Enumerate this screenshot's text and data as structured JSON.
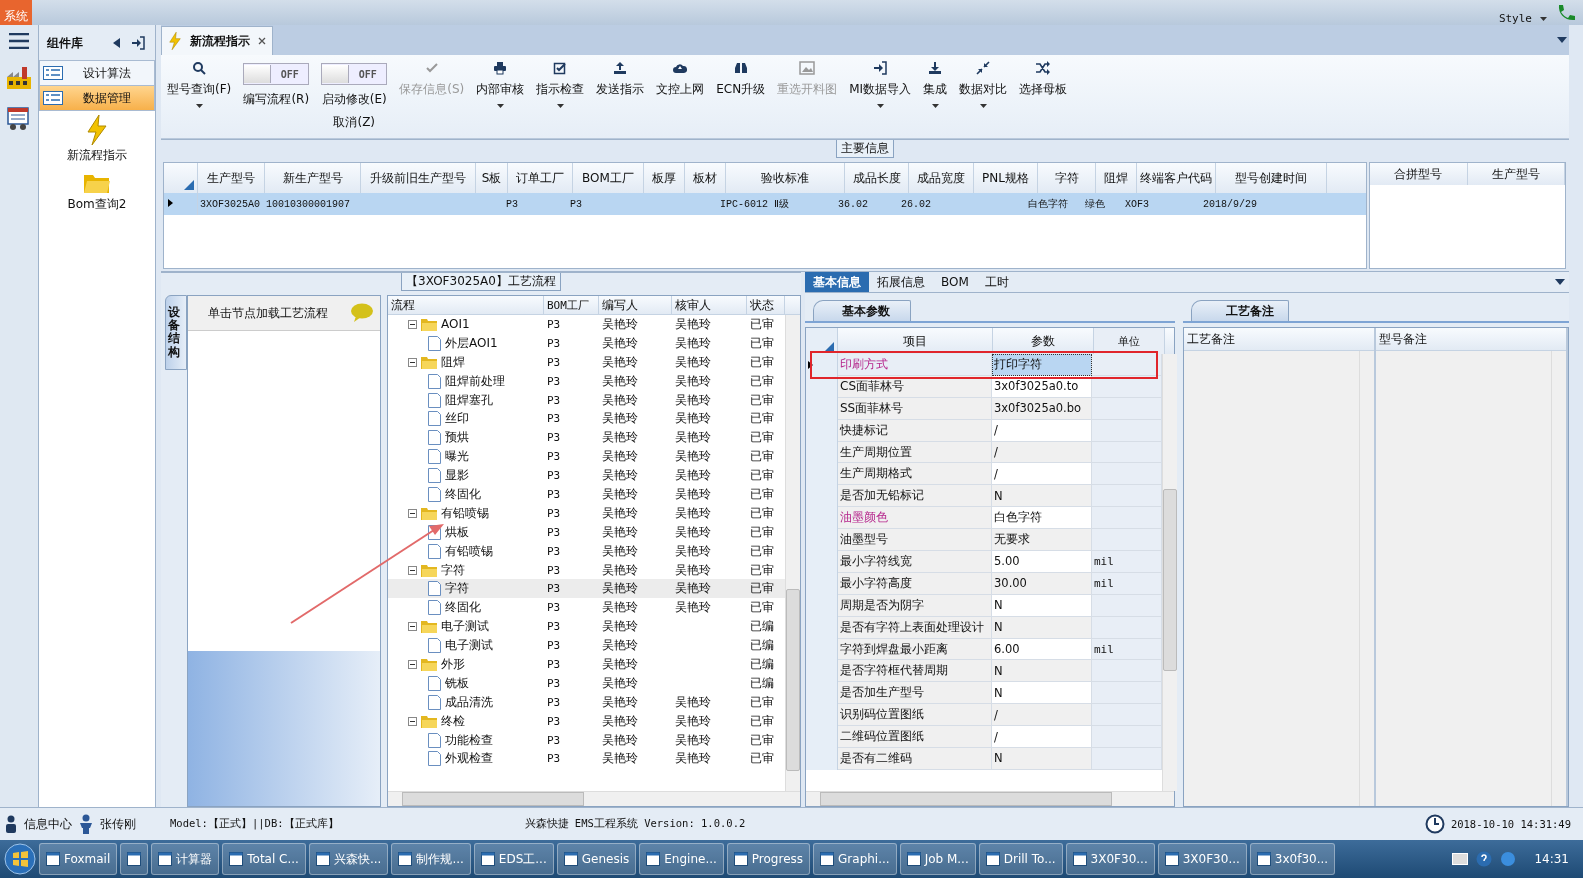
{
  "title_bar": {
    "system_tab": "系统",
    "style_menu": "Style"
  },
  "nav_panel": {
    "title": "组件库",
    "items": [
      {
        "label": "设计算法",
        "selected": false
      },
      {
        "label": "数据管理",
        "selected": true
      }
    ],
    "shortcuts": [
      "新流程指示",
      "Bom查询2"
    ]
  },
  "doc_tab": {
    "label": "新流程指示"
  },
  "toolbar": [
    {
      "kind": "button",
      "label": "型号查询(F)",
      "dropdown": true,
      "disabled": false
    },
    {
      "kind": "toggle",
      "label": "编写流程(R)",
      "state_text": "OFF",
      "on": false
    },
    {
      "kind": "toggle",
      "label": "启动修改(E)",
      "sublabel": "取消(Z)",
      "state_text": "OFF",
      "on": false
    },
    {
      "kind": "button",
      "label": "保存信息(S)",
      "dropdown": false,
      "disabled": true
    },
    {
      "kind": "button",
      "label": "内部审核",
      "dropdown": true,
      "disabled": false
    },
    {
      "kind": "button",
      "label": "指示检查",
      "dropdown": true,
      "disabled": false
    },
    {
      "kind": "button",
      "label": "发送指示",
      "dropdown": false,
      "disabled": false
    },
    {
      "kind": "button",
      "label": "文控上网",
      "dropdown": false,
      "disabled": false
    },
    {
      "kind": "button",
      "label": "ECN升级",
      "dropdown": false,
      "disabled": false
    },
    {
      "kind": "button",
      "label": "重选开料图",
      "dropdown": false,
      "disabled": true
    },
    {
      "kind": "button",
      "label": "MI数据导入",
      "dropdown": true,
      "disabled": false
    },
    {
      "kind": "button",
      "label": "集成",
      "dropdown": true,
      "disabled": false
    },
    {
      "kind": "button",
      "label": "数据对比",
      "dropdown": true,
      "disabled": false
    },
    {
      "kind": "button",
      "label": "选择母板",
      "dropdown": false,
      "disabled": false
    }
  ],
  "main_info": {
    "title": "主要信息",
    "columns": [
      "生产型号",
      "新生产型号",
      "升级前旧生产型号",
      "S板",
      "订单工厂",
      "BOM工厂",
      "板厚",
      "板材",
      "验收标准",
      "成品长度",
      "成品宽度",
      "PNL规格",
      "字符",
      "阻焊",
      "终端客户代码",
      "型号创建时间"
    ],
    "rows": [
      {
        "selected": true,
        "cells": [
          "3XOF3025A0",
          "10010300001907",
          null,
          null,
          "P3",
          "P3",
          null,
          null,
          "IPC-6012 Ⅱ级",
          "36.02",
          "26.02",
          null,
          "白色字符",
          "绿色",
          "XOF3",
          "2018/9/29"
        ]
      }
    ],
    "side_columns": [
      "合拼型号",
      "生产型号"
    ]
  },
  "process_panel": {
    "title": "【3XOF3025A0】工艺流程",
    "side_tab": "设备结构",
    "hint": "单击节点加载工艺流程",
    "tree": {
      "columns": [
        "流程",
        "BOM工厂",
        "编写人",
        "核审人",
        "状态"
      ],
      "nodes": [
        {
          "name": "AOI1",
          "bom": "P3",
          "writer": "吴艳玲",
          "reviewer": "吴艳玲",
          "status": "已审",
          "expanded": true,
          "selected": false,
          "children": [
            {
              "name": "外层AOI1",
              "bom": "P3",
              "writer": "吴艳玲",
              "reviewer": "吴艳玲",
              "status": "已审",
              "selected": false
            }
          ]
        },
        {
          "name": "阻焊",
          "bom": "P3",
          "writer": "吴艳玲",
          "reviewer": "吴艳玲",
          "status": "已审",
          "expanded": true,
          "selected": false,
          "children": [
            {
              "name": "阻焊前处理",
              "bom": "P3",
              "writer": "吴艳玲",
              "reviewer": "吴艳玲",
              "status": "已审",
              "selected": false
            },
            {
              "name": "阻焊塞孔",
              "bom": "P3",
              "writer": "吴艳玲",
              "reviewer": "吴艳玲",
              "status": "已审",
              "selected": false
            },
            {
              "name": "丝印",
              "bom": "P3",
              "writer": "吴艳玲",
              "reviewer": "吴艳玲",
              "status": "已审",
              "selected": false
            },
            {
              "name": "预烘",
              "bom": "P3",
              "writer": "吴艳玲",
              "reviewer": "吴艳玲",
              "status": "已审",
              "selected": false
            },
            {
              "name": "曝光",
              "bom": "P3",
              "writer": "吴艳玲",
              "reviewer": "吴艳玲",
              "status": "已审",
              "selected": false
            },
            {
              "name": "显影",
              "bom": "P3",
              "writer": "吴艳玲",
              "reviewer": "吴艳玲",
              "status": "已审",
              "selected": false
            },
            {
              "name": "终固化",
              "bom": "P3",
              "writer": "吴艳玲",
              "reviewer": "吴艳玲",
              "status": "已审",
              "selected": false
            }
          ]
        },
        {
          "name": "有铅喷锡",
          "bom": "P3",
          "writer": "吴艳玲",
          "reviewer": "吴艳玲",
          "status": "已审",
          "expanded": true,
          "selected": false,
          "children": [
            {
              "name": "烘板",
              "bom": "P3",
              "writer": "吴艳玲",
              "reviewer": "吴艳玲",
              "status": "已审",
              "selected": false
            },
            {
              "name": "有铅喷锡",
              "bom": "P3",
              "writer": "吴艳玲",
              "reviewer": "吴艳玲",
              "status": "已审",
              "selected": false
            }
          ]
        },
        {
          "name": "字符",
          "bom": "P3",
          "writer": "吴艳玲",
          "reviewer": "吴艳玲",
          "status": "已审",
          "expanded": true,
          "selected": false,
          "children": [
            {
              "name": "字符",
              "bom": "P3",
              "writer": "吴艳玲",
              "reviewer": "吴艳玲",
              "status": "已审",
              "selected": true
            },
            {
              "name": "终固化",
              "bom": "P3",
              "writer": "吴艳玲",
              "reviewer": "吴艳玲",
              "status": "已审",
              "selected": false
            }
          ]
        },
        {
          "name": "电子测试",
          "bom": "P3",
          "writer": "吴艳玲",
          "status": "已编",
          "expanded": true,
          "selected": false,
          "children": [
            {
              "name": "电子测试",
              "bom": "P3",
              "writer": "吴艳玲",
              "status": "已编",
              "selected": false
            }
          ]
        },
        {
          "name": "外形",
          "bom": "P3",
          "writer": "吴艳玲",
          "status": "已编",
          "expanded": true,
          "selected": false,
          "children": [
            {
              "name": "铣板",
              "bom": "P3",
              "writer": "吴艳玲",
              "status": "已编",
              "selected": false
            },
            {
              "name": "成品清洗",
              "bom": "P3",
              "writer": "吴艳玲",
              "reviewer": "吴艳玲",
              "status": "已审",
              "selected": false
            }
          ]
        },
        {
          "name": "终检",
          "bom": "P3",
          "writer": "吴艳玲",
          "reviewer": "吴艳玲",
          "status": "已审",
          "expanded": true,
          "selected": false,
          "children": [
            {
              "name": "功能检查",
              "bom": "P3",
              "writer": "吴艳玲",
              "reviewer": "吴艳玲",
              "status": "已审",
              "selected": false
            },
            {
              "name": "外观检查",
              "bom": "P3",
              "writer": "吴艳玲",
              "reviewer": "吴艳玲",
              "status": "已审",
              "selected": false
            }
          ]
        }
      ]
    }
  },
  "detail_tabs": [
    {
      "label": "基本信息",
      "selected": true
    },
    {
      "label": "拓展信息",
      "selected": false
    },
    {
      "label": "BOM",
      "selected": false
    },
    {
      "label": "工时",
      "selected": false
    }
  ],
  "params": {
    "tab": "基本参数",
    "columns": [
      "项目",
      "参数",
      "单位"
    ],
    "rows": [
      {
        "item": "印刷方式",
        "value": "打印字符",
        "required": true,
        "selected": true
      },
      {
        "item": "CS面菲林号",
        "value": "3x0f3025a0.to",
        "required": false,
        "selected": false
      },
      {
        "item": "SS面菲林号",
        "value": "3x0f3025a0.bo",
        "required": false,
        "selected": false
      },
      {
        "item": "快捷标记",
        "value": "/",
        "required": false,
        "selected": false
      },
      {
        "item": "生产周期位置",
        "value": "/",
        "required": false,
        "selected": false
      },
      {
        "item": "生产周期格式",
        "value": "/",
        "required": false,
        "selected": false
      },
      {
        "item": "是否加无铅标记",
        "value": "N",
        "required": false,
        "selected": false
      },
      {
        "item": "油墨颜色",
        "value": "白色字符",
        "required": true,
        "selected": false
      },
      {
        "item": "油墨型号",
        "value": "无要求",
        "required": false,
        "selected": false
      },
      {
        "item": "最小字符线宽",
        "value": "5.00",
        "unit": "mil",
        "required": false,
        "selected": false
      },
      {
        "item": "最小字符高度",
        "value": "30.00",
        "unit": "mil",
        "required": false,
        "selected": false
      },
      {
        "item": "周期是否为阴字",
        "value": "N",
        "required": false,
        "selected": false
      },
      {
        "item": "是否有字符上表面处理设计",
        "value": "N",
        "required": false,
        "selected": false
      },
      {
        "item": "字符到焊盘最小距离",
        "value": "6.00",
        "unit": "mil",
        "required": false,
        "selected": false
      },
      {
        "item": "是否字符框代替周期",
        "value": "N",
        "required": false,
        "selected": false
      },
      {
        "item": "是否加生产型号",
        "value": "N",
        "required": false,
        "selected": false
      },
      {
        "item": "识别码位置图纸",
        "value": "/",
        "required": false,
        "selected": false
      },
      {
        "item": "二维码位置图纸",
        "value": "/",
        "required": false,
        "selected": false
      },
      {
        "item": "是否有二维码",
        "value": "N",
        "required": false,
        "selected": false
      }
    ]
  },
  "remarks": {
    "tab": "工艺备注",
    "columns": [
      "工艺备注",
      "型号备注"
    ]
  },
  "status_bar": {
    "info_center": "信息中心",
    "user": "张传刚",
    "model": "Model:【正式】||DB:【正式库】",
    "app": "兴森快捷 EMS工程系统 Version: 1.0.0.2",
    "datetime": "2018-10-10 14:31:49"
  },
  "taskbar": {
    "items": [
      {
        "kind": "window",
        "label": "Foxmail"
      },
      {
        "kind": "icon_only"
      },
      {
        "kind": "window",
        "label": "计算器"
      },
      {
        "kind": "window",
        "label": "Total C..."
      },
      {
        "kind": "window",
        "label": "兴森快..."
      },
      {
        "kind": "window",
        "label": "制作规..."
      },
      {
        "kind": "window",
        "label": "EDS工..."
      },
      {
        "kind": "window",
        "label": "Genesis"
      },
      {
        "kind": "window",
        "label": "Engine..."
      },
      {
        "kind": "window",
        "label": "Progress"
      },
      {
        "kind": "window",
        "label": "Graphi..."
      },
      {
        "kind": "window",
        "label": "Job M..."
      },
      {
        "kind": "window",
        "label": "Drill To..."
      },
      {
        "kind": "window",
        "label": "3X0F30..."
      },
      {
        "kind": "window",
        "label": "3X0F30..."
      },
      {
        "kind": "window",
        "label": "3x0f30..."
      }
    ],
    "clock": "14:31"
  }
}
